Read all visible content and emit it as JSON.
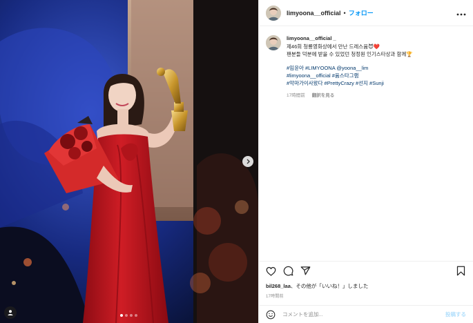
{
  "header": {
    "username": "limyoona__official",
    "separator": "•",
    "follow_label": "フォロー",
    "more_icon": "more-horizontal-icon"
  },
  "caption": {
    "username": "limyoona__official _",
    "line1": "제46회 청룡영화상에서 만난 드레스윰😈❤️",
    "line2": "팬분들 덕분에 받을 수 있었던 청정원 인기스타상과 함께🏆",
    "hashtags": [
      "#임윤아 #LIMYOONA @yoona__lim",
      "#limyoona__official #윰스타그램",
      "#악마가이사왔다 #PrettyCrazy #선지 #Sunji"
    ],
    "time": "17時間前",
    "translate_label": "翻訳を見る"
  },
  "actions": {
    "icons": [
      "heart-icon",
      "comment-icon",
      "share-icon",
      "bookmark-icon"
    ]
  },
  "likes": {
    "user": "bil268_laa",
    "text": "、その他が「いいね！」しました"
  },
  "post_time": "17時間前",
  "comment": {
    "placeholder": "コメントを追加...",
    "post_label": "投稿する"
  },
  "colors": {
    "accent": "#0095f6",
    "hashtag": "#00376b",
    "dress": "#c0141c"
  }
}
